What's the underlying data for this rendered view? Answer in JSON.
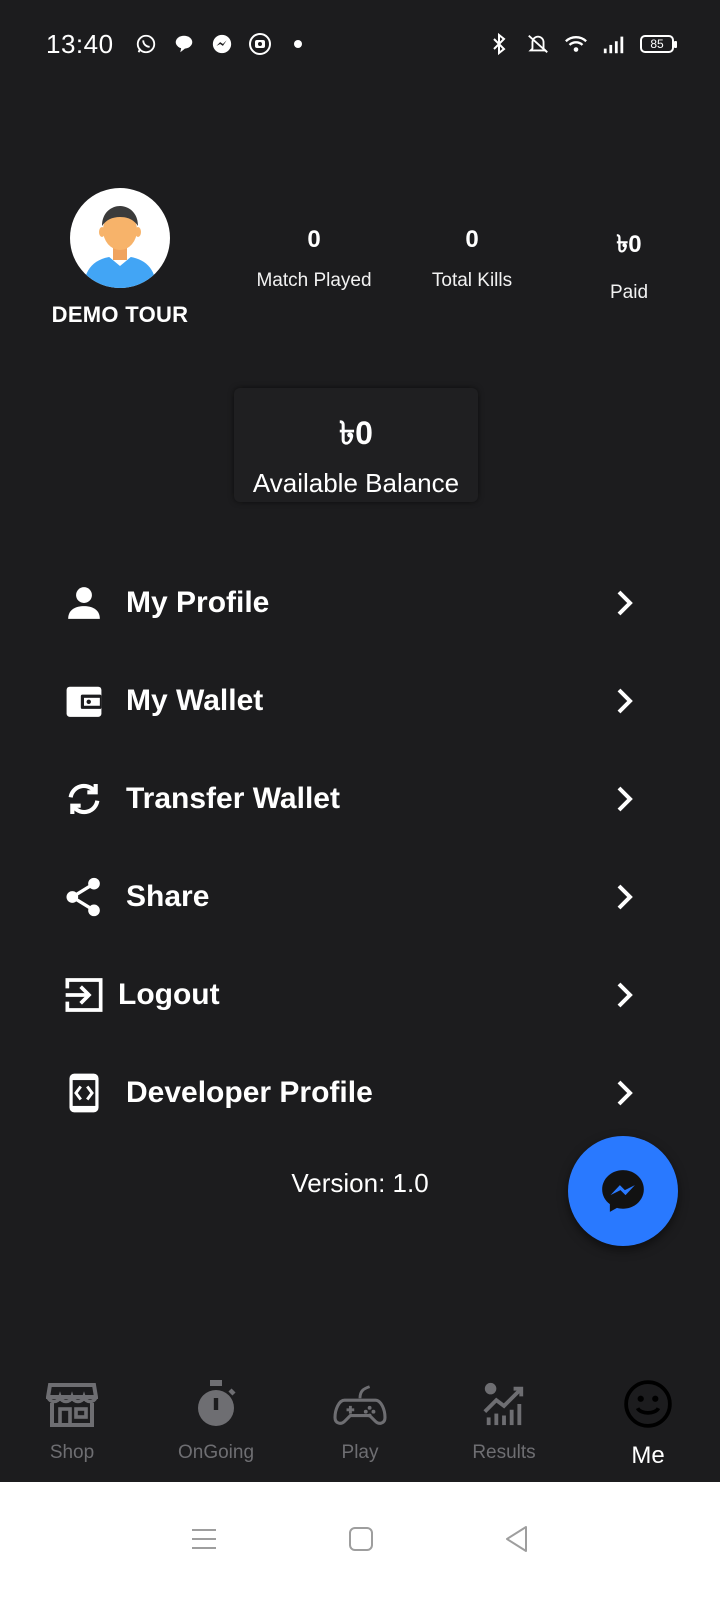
{
  "status_bar": {
    "time": "13:40",
    "battery": "85",
    "left_icons": [
      "whatsapp-icon",
      "chat-bubble-icon",
      "messenger-icon",
      "app-badge-icon",
      "dot-icon"
    ],
    "right_icons": [
      "bluetooth-icon",
      "mute-icon",
      "wifi-icon",
      "signal-icon",
      "battery-icon"
    ]
  },
  "profile": {
    "username": "DEMO TOUR",
    "avatar_icon": "user-avatar-icon"
  },
  "stats": [
    {
      "value": "0",
      "label": "Match Played"
    },
    {
      "value": "0",
      "label": "Total Kills"
    },
    {
      "value": "৳0",
      "label": "Paid"
    }
  ],
  "balance": {
    "value": "৳0",
    "label": "Available Balance"
  },
  "menu": [
    {
      "label": "My Profile",
      "icon": "person-icon"
    },
    {
      "label": "My Wallet",
      "icon": "wallet-icon"
    },
    {
      "label": "Transfer Wallet",
      "icon": "sync-icon"
    },
    {
      "label": "Share",
      "icon": "share-icon"
    },
    {
      "label": "Logout",
      "icon": "logout-icon"
    },
    {
      "label": "Developer Profile",
      "icon": "developer-icon"
    }
  ],
  "version": "Version: 1.0",
  "fab_icon": "messenger-icon",
  "bottom_nav": {
    "items": [
      {
        "label": "Shop",
        "icon": "store-icon"
      },
      {
        "label": "OnGoing",
        "icon": "timer-icon"
      },
      {
        "label": "Play",
        "icon": "gamepad-icon"
      },
      {
        "label": "Results",
        "icon": "chart-icon"
      },
      {
        "label": "Me",
        "icon": "smiley-icon"
      }
    ],
    "active": "Me"
  },
  "system_nav": [
    "menu-icon",
    "home-icon",
    "back-icon"
  ],
  "colors": {
    "background": "#1c1c1e",
    "fab": "#2979ff",
    "nav_inactive": "#6e6e72",
    "text": "#ffffff"
  }
}
